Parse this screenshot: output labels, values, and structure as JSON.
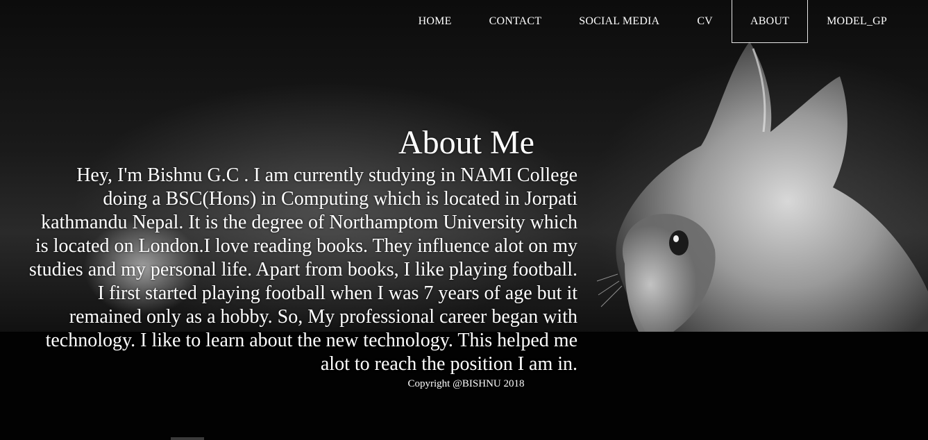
{
  "nav": {
    "items": [
      {
        "label": "HOME"
      },
      {
        "label": "CONTACT"
      },
      {
        "label": "SOCIAL MEDIA"
      },
      {
        "label": "CV"
      },
      {
        "label": "ABOUT"
      },
      {
        "label": "MODEL_GP"
      }
    ],
    "active": "ABOUT"
  },
  "about": {
    "title": "About Me",
    "body": "Hey, I'm Bishnu G.C . I am currently studying in NAMI College doing a BSC(Hons) in Computing which is located in Jorpati kathmandu Nepal. It is the degree of Northamptom University which is located on London.I love reading books. They influence alot on my studies and my personal life. Apart from books, I like playing football. I first started playing football when I was 7 years of age but it remained only as a hobby. So, My professional career began with technology. I like to learn about the new technology. This helped me alot to reach the position I am in."
  },
  "footer": {
    "copyright": "Copyright @BISHNU 2018"
  },
  "colors": {
    "background": "#000000",
    "text": "#ffffff",
    "active_border": "#e8e8e8"
  },
  "background_image": "black-and-white-cat-photo"
}
